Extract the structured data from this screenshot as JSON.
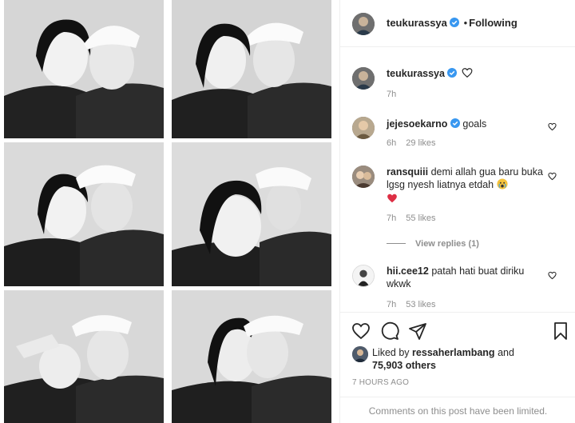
{
  "post": {
    "author": "teukurassya",
    "follow_status": "Following",
    "caption_time": "7h",
    "time_ago": "7 HOURS AGO",
    "comments_limited": "Comments on this post have been limited."
  },
  "comments": [
    {
      "user": "jejesoekarno",
      "verified": true,
      "text": "goals",
      "time": "6h",
      "likes": "29 likes"
    },
    {
      "user": "ransquiii",
      "verified": false,
      "text": "demi allah gua baru buka lgsg nyesh liatnya etdah",
      "emoji_icon": "crying-face-emoji",
      "second_line_icon": "red-heart-emoji",
      "time": "7h",
      "likes": "55 likes",
      "view_replies": "View replies (1)"
    },
    {
      "user": "hii.cee12",
      "verified": false,
      "text": "patah hati buat diriku wkwk",
      "time": "7h",
      "likes": "53 likes"
    }
  ],
  "likes": {
    "prefix": "Liked by",
    "user": "ressaherlambang",
    "connector": "and",
    "others": "75,903 others"
  },
  "icons": {
    "verified": "verified-badge-icon",
    "like": "heart-icon",
    "comment": "comment-bubble-icon",
    "share": "paper-plane-icon",
    "save": "bookmark-icon"
  },
  "colors": {
    "verified_blue": "#3897f0",
    "text": "#262626",
    "muted": "#8e8e8e",
    "border": "#efefef"
  }
}
